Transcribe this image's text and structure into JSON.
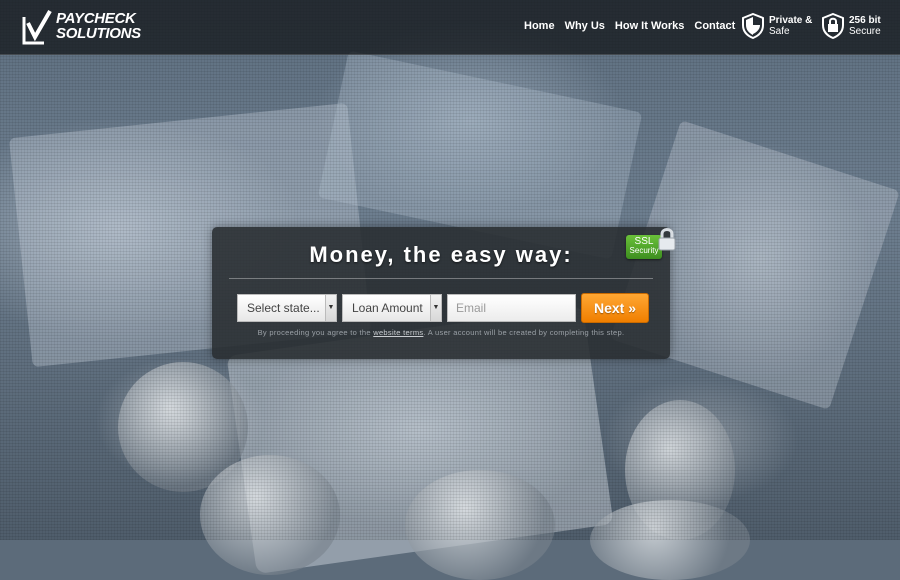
{
  "brand": {
    "line1": "PAYCHECK",
    "line2": "SOLUTIONS"
  },
  "nav": {
    "items": [
      "Home",
      "Why Us",
      "How It Works",
      "Contact"
    ]
  },
  "badges": {
    "privacy": {
      "line1": "Private &",
      "line2": "Safe",
      "icon": "shield-icon"
    },
    "security": {
      "line1": "256 bit",
      "line2": "Secure",
      "icon": "lock-shield-icon"
    }
  },
  "form": {
    "headline": "Money, the easy way:",
    "ssl_badge": {
      "line1": "SSL",
      "line2": "Security"
    },
    "state_select": "Select state...",
    "loan_select": "Loan Amount",
    "email_placeholder": "Email",
    "next_button": "Next »",
    "fine_print_before": "By proceeding you agree to the",
    "fine_print_link": "website terms",
    "fine_print_after": ". A user account will be created by completing this step."
  },
  "colors": {
    "accent_orange": "#f07f00",
    "ssl_green": "#4aa52a",
    "header_bg": "#161a1e"
  }
}
